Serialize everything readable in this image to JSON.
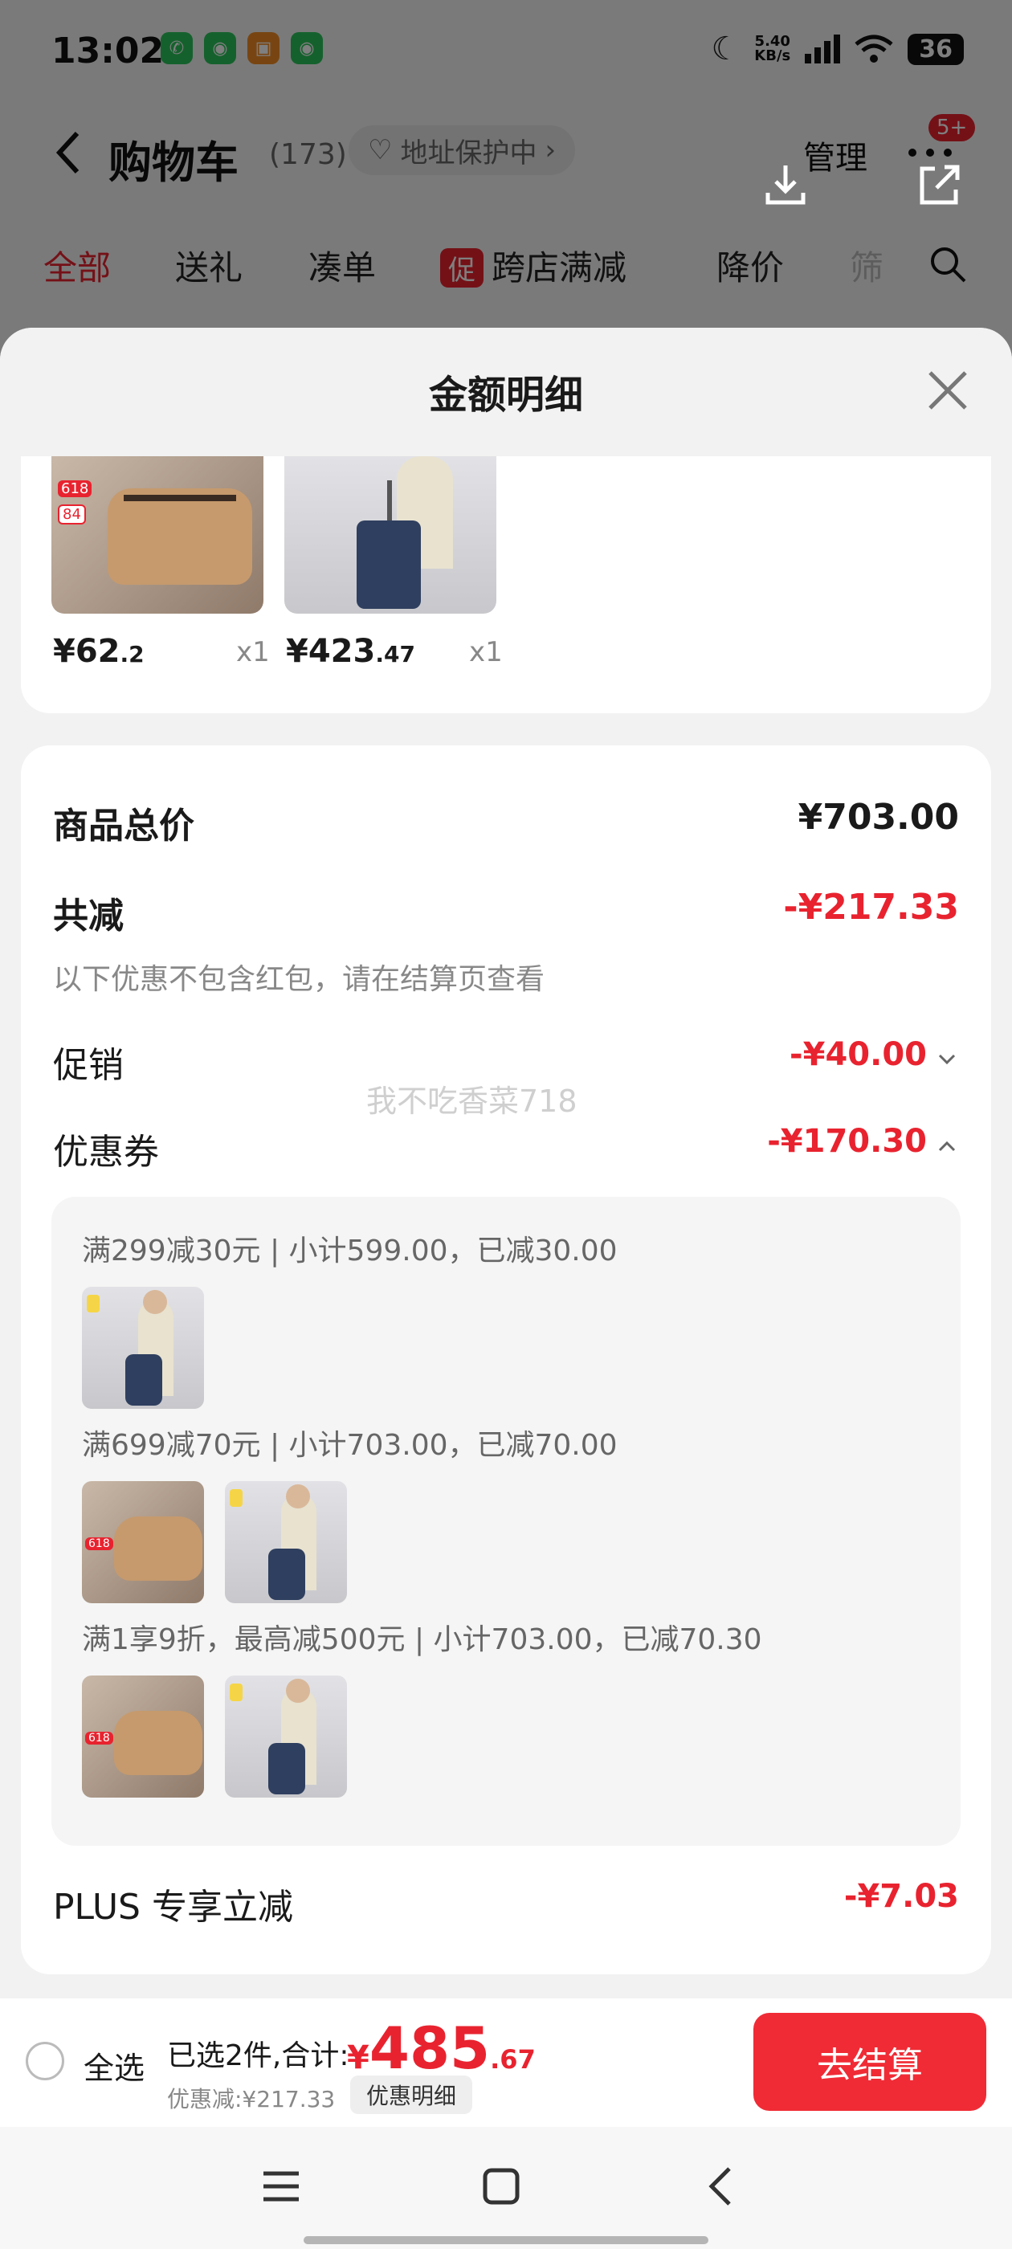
{
  "status_bar": {
    "time": "13:02",
    "net_speed_top": "5.40",
    "net_speed_bottom": "KB/s",
    "battery": "36"
  },
  "header": {
    "title": "购物车",
    "count": "(173)",
    "address": "地址保护中",
    "manage": "管理",
    "badge": "5+"
  },
  "tabs": [
    {
      "label": "全部"
    },
    {
      "label": "送礼"
    },
    {
      "label": "凑单"
    },
    {
      "tag": "促",
      "label": "跨店满减"
    },
    {
      "label": "降价"
    },
    {
      "label": "筛"
    }
  ],
  "sheet": {
    "title": "金额明细",
    "products": [
      {
        "price_int": "¥62",
        "price_dec": ".2",
        "qty": "x1",
        "sticker": "618",
        "sticker2": "84"
      },
      {
        "price_int": "¥423",
        "price_dec": ".47",
        "qty": "x1"
      }
    ],
    "total_label": "商品总价",
    "total_value": "¥703.00",
    "reduce_label": "共减",
    "reduce_value": "-¥217.33",
    "note": "以下优惠不包含红包，请在结算页查看",
    "promo_label": "促销",
    "promo_value": "-¥40.00",
    "watermark": "我不吃香菜718",
    "coupon_label": "优惠券",
    "coupon_value": "-¥170.30",
    "coupon_rules": [
      "满299减30元 | 小计599.00，已减30.00",
      "满699减70元 | 小计703.00，已减70.00",
      "满1享9折，最高减500元 | 小计703.00，已减70.30"
    ],
    "plus_label": "PLUS 专享立减",
    "plus_value": "-¥7.03"
  },
  "checkout": {
    "select_all": "全选",
    "selected": "已选2件,合计:",
    "yen": "¥",
    "total_int": "485",
    "total_dec": ".67",
    "discount": "优惠减:¥217.33",
    "detail_button": "优惠明细",
    "button": "去结算"
  },
  "colors": {
    "accent": "#e8232f",
    "button": "#f02b35"
  }
}
